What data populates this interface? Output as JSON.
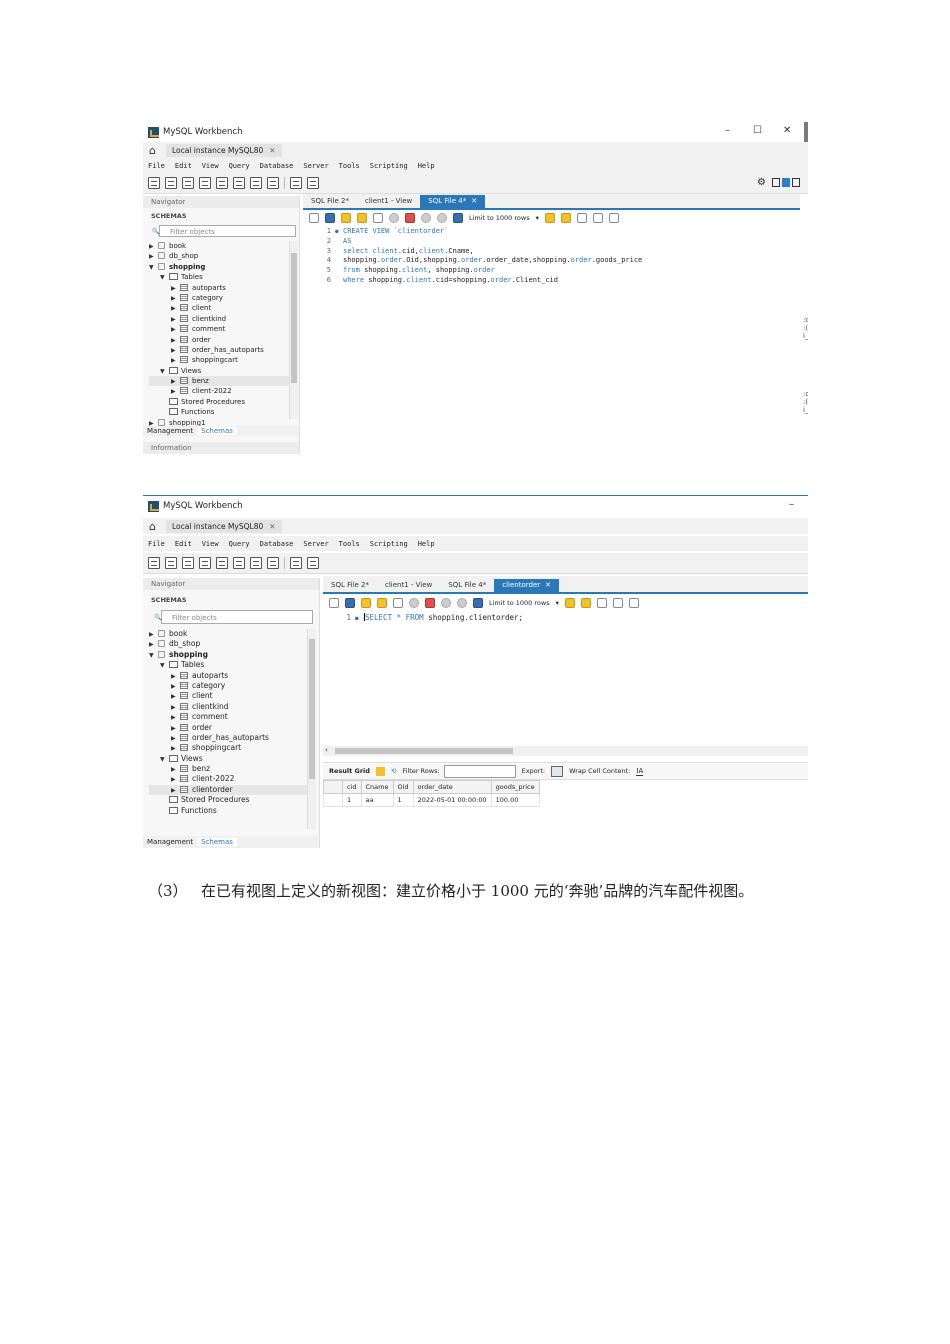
{
  "screenshot1": {
    "window_title": "MySQL Workbench",
    "conn_tab": "Local instance MySQL80",
    "menu": [
      "File",
      "Edit",
      "View",
      "Query",
      "Database",
      "Server",
      "Tools",
      "Scripting",
      "Help"
    ],
    "navigator_label": "Navigator",
    "schemas_label": "SCHEMAS",
    "filter_placeholder": "Filter objects",
    "tree": [
      {
        "level": 0,
        "arrow": "▶",
        "icon": "db",
        "label": "book"
      },
      {
        "level": 0,
        "arrow": "▶",
        "icon": "db",
        "label": "db_shop"
      },
      {
        "level": 0,
        "arrow": "▼",
        "icon": "db",
        "label": "shopping",
        "bold": true
      },
      {
        "level": 1,
        "arrow": "▼",
        "icon": "folder",
        "label": "Tables"
      },
      {
        "level": 2,
        "arrow": "▶",
        "icon": "table",
        "label": "autoparts"
      },
      {
        "level": 2,
        "arrow": "▶",
        "icon": "table",
        "label": "category"
      },
      {
        "level": 2,
        "arrow": "▶",
        "icon": "table",
        "label": "client"
      },
      {
        "level": 2,
        "arrow": "▶",
        "icon": "table",
        "label": "clientkind"
      },
      {
        "level": 2,
        "arrow": "▶",
        "icon": "table",
        "label": "comment"
      },
      {
        "level": 2,
        "arrow": "▶",
        "icon": "table",
        "label": "order"
      },
      {
        "level": 2,
        "arrow": "▶",
        "icon": "table",
        "label": "order_has_autoparts"
      },
      {
        "level": 2,
        "arrow": "▶",
        "icon": "table",
        "label": "shoppingcart"
      },
      {
        "level": 1,
        "arrow": "▼",
        "icon": "folder",
        "label": "Views"
      },
      {
        "level": 2,
        "arrow": "▶",
        "icon": "table",
        "label": "benz",
        "selected": true
      },
      {
        "level": 2,
        "arrow": "▶",
        "icon": "table",
        "label": "client-2022"
      },
      {
        "level": 1,
        "arrow": "",
        "icon": "folder",
        "label": "Stored Procedures"
      },
      {
        "level": 1,
        "arrow": "",
        "icon": "folder",
        "label": "Functions"
      },
      {
        "level": 0,
        "arrow": "▶",
        "icon": "db",
        "label": "shopping1"
      }
    ],
    "nav_tabs": [
      "Management",
      "Schemas"
    ],
    "information_label": "Information",
    "sql_tabs": [
      {
        "label": "SQL File 2*",
        "active": false
      },
      {
        "label": "client1 - View",
        "active": false
      },
      {
        "label": "SQL File 4*",
        "active": true
      }
    ],
    "limit_label": "Limit to 1000 rows",
    "code": [
      {
        "n": "1",
        "dot": true,
        "tokens": [
          {
            "t": "CREATE VIEW `clientorder`",
            "c": "kw"
          }
        ]
      },
      {
        "n": "2",
        "tokens": [
          {
            "t": "AS",
            "c": "kw"
          }
        ]
      },
      {
        "n": "3",
        "tokens": [
          {
            "t": "select ",
            "c": "kw"
          },
          {
            "t": "client",
            "c": "kw"
          },
          {
            "t": ".cid,",
            "c": "id"
          },
          {
            "t": "client",
            "c": "kw"
          },
          {
            "t": ".Cname,",
            "c": "id"
          }
        ]
      },
      {
        "n": "4",
        "tokens": [
          {
            "t": "shopping.",
            "c": "id"
          },
          {
            "t": "order",
            "c": "kw"
          },
          {
            "t": ".Oid,shopping.",
            "c": "id"
          },
          {
            "t": "order",
            "c": "kw"
          },
          {
            "t": ".order_date,shopping.",
            "c": "id"
          },
          {
            "t": "order",
            "c": "kw"
          },
          {
            "t": ".goods_price",
            "c": "id"
          }
        ]
      },
      {
        "n": "5",
        "tokens": [
          {
            "t": "from ",
            "c": "kw"
          },
          {
            "t": "shopping.",
            "c": "id"
          },
          {
            "t": "client",
            "c": "kw"
          },
          {
            "t": ", shopping.",
            "c": "id"
          },
          {
            "t": "order",
            "c": "kw"
          }
        ]
      },
      {
        "n": "6",
        "tokens": [
          {
            "t": "where ",
            "c": "kw"
          },
          {
            "t": "shopping.",
            "c": "id"
          },
          {
            "t": "client",
            "c": "kw"
          },
          {
            "t": ".cid=shopping.",
            "c": "id"
          },
          {
            "t": "order",
            "c": "kw"
          },
          {
            "t": ".Client_cid",
            "c": "id"
          }
        ]
      }
    ]
  },
  "screenshot2": {
    "window_title": "MySQL Workbench",
    "conn_tab": "Local instance MySQL80",
    "menu": [
      "File",
      "Edit",
      "View",
      "Query",
      "Database",
      "Server",
      "Tools",
      "Scripting",
      "Help"
    ],
    "navigator_label": "Navigator",
    "schemas_label": "SCHEMAS",
    "filter_placeholder": "Filter objects",
    "tree": [
      {
        "level": 0,
        "arrow": "▶",
        "icon": "db",
        "label": "book"
      },
      {
        "level": 0,
        "arrow": "▶",
        "icon": "db",
        "label": "db_shop"
      },
      {
        "level": 0,
        "arrow": "▼",
        "icon": "db",
        "label": "shopping",
        "bold": true
      },
      {
        "level": 1,
        "arrow": "▼",
        "icon": "folder",
        "label": "Tables"
      },
      {
        "level": 2,
        "arrow": "▶",
        "icon": "table",
        "label": "autoparts"
      },
      {
        "level": 2,
        "arrow": "▶",
        "icon": "table",
        "label": "category"
      },
      {
        "level": 2,
        "arrow": "▶",
        "icon": "table",
        "label": "client"
      },
      {
        "level": 2,
        "arrow": "▶",
        "icon": "table",
        "label": "clientkind"
      },
      {
        "level": 2,
        "arrow": "▶",
        "icon": "table",
        "label": "comment"
      },
      {
        "level": 2,
        "arrow": "▶",
        "icon": "table",
        "label": "order"
      },
      {
        "level": 2,
        "arrow": "▶",
        "icon": "table",
        "label": "order_has_autoparts"
      },
      {
        "level": 2,
        "arrow": "▶",
        "icon": "table",
        "label": "shoppingcart"
      },
      {
        "level": 1,
        "arrow": "▼",
        "icon": "folder",
        "label": "Views"
      },
      {
        "level": 2,
        "arrow": "▶",
        "icon": "table",
        "label": "benz"
      },
      {
        "level": 2,
        "arrow": "▶",
        "icon": "table",
        "label": "client-2022"
      },
      {
        "level": 2,
        "arrow": "▶",
        "icon": "table",
        "label": "clientorder",
        "selected": true
      },
      {
        "level": 1,
        "arrow": "",
        "icon": "folder",
        "label": "Stored Procedures"
      },
      {
        "level": 1,
        "arrow": "",
        "icon": "folder",
        "label": "Functions"
      }
    ],
    "nav_tabs": [
      "Management",
      "Schemas"
    ],
    "sql_tabs": [
      {
        "label": "SQL File 2*",
        "active": false
      },
      {
        "label": "client1 - View",
        "active": false
      },
      {
        "label": "SQL File 4*",
        "active": false
      },
      {
        "label": "clientorder",
        "active": true
      }
    ],
    "limit_label": "Limit to 1000 rows",
    "code": [
      {
        "n": "1",
        "dot": true,
        "caret": true,
        "tokens": [
          {
            "t": "SELECT * FROM ",
            "c": "kw"
          },
          {
            "t": "shopping.clientorder;",
            "c": "id"
          }
        ]
      }
    ],
    "result_bar": {
      "grid": "Result Grid",
      "filter": "Filter Rows:",
      "export": "Export:",
      "wrap": "Wrap Cell Content:"
    },
    "result": {
      "columns": [
        "cid",
        "Cname",
        "Oid",
        "order_date",
        "goods_price"
      ],
      "rows": [
        [
          "1",
          "aa",
          "1",
          "2022-05-01 00:00:00",
          "100.00"
        ]
      ]
    }
  },
  "caption": {
    "number": "（3）",
    "text": "在已有视图上定义的新视图：建立价格小于 1000 元的‘奔驰’品牌的汽车配件视图。"
  }
}
